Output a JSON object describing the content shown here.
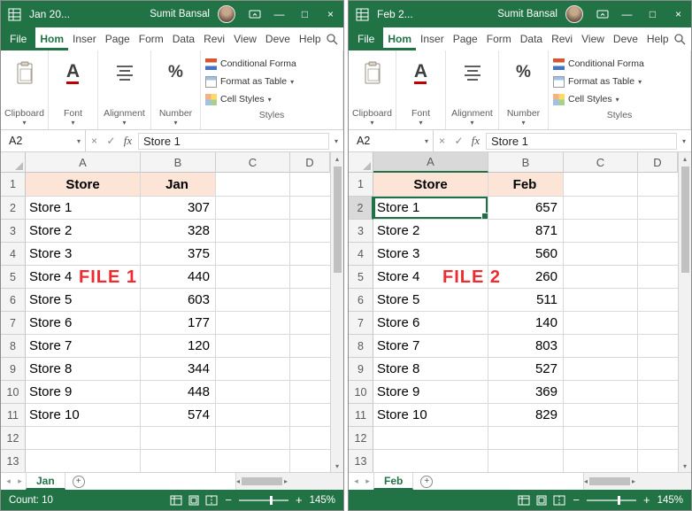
{
  "colors": {
    "excel_green": "#217346",
    "header_fill": "#FCE4D6",
    "overlay_red": "#EE2B2E"
  },
  "glyphs": {
    "caret_down": "▾",
    "minimize": "—",
    "maximize": "□",
    "close": "×",
    "cancel": "×",
    "enter": "✓",
    "fx": "fx",
    "up": "▴",
    "down": "▾",
    "left": "◂",
    "right": "▸",
    "plus": "+",
    "minus": "−"
  },
  "windows": [
    {
      "title": "Jan 20...",
      "user": "Sumit Bansal",
      "ribbon_tabs": [
        "File",
        "Hom",
        "Inser",
        "Page",
        "Form",
        "Data",
        "Revi",
        "View",
        "Deve",
        "Help"
      ],
      "groups": {
        "clipboard": "Clipboard",
        "font": "Font",
        "alignment": "Alignment",
        "number": "Number",
        "styles": "Styles",
        "conditional": "Conditional Forma",
        "format_table": "Format as Table",
        "cell_styles": "Cell Styles"
      },
      "name_box": "A2",
      "formula": "Store 1",
      "col_headers": [
        "A",
        "B",
        "C",
        "D"
      ],
      "row_numbers": [
        "1",
        "2",
        "3",
        "4",
        "5",
        "6",
        "7",
        "8",
        "9",
        "10",
        "11",
        "12",
        "13"
      ],
      "header_row": {
        "a": "Store",
        "b": "Jan"
      },
      "rows": [
        {
          "a": "Store 1",
          "b": "307"
        },
        {
          "a": "Store 2",
          "b": "328"
        },
        {
          "a": "Store 3",
          "b": "375"
        },
        {
          "a": "Store 4",
          "b": "440"
        },
        {
          "a": "Store 5",
          "b": "603"
        },
        {
          "a": "Store 6",
          "b": "177"
        },
        {
          "a": "Store 7",
          "b": "120"
        },
        {
          "a": "Store 8",
          "b": "344"
        },
        {
          "a": "Store 9",
          "b": "448"
        },
        {
          "a": "Store 10",
          "b": "574"
        }
      ],
      "overlay": "FILE 1",
      "sheet_tab": "Jan",
      "status": {
        "left": "Count: 10",
        "zoom": "145%"
      }
    },
    {
      "title": "Feb 2...",
      "user": "Sumit Bansal",
      "ribbon_tabs": [
        "File",
        "Hom",
        "Inser",
        "Page",
        "Form",
        "Data",
        "Revi",
        "View",
        "Deve",
        "Help"
      ],
      "groups": {
        "clipboard": "Clipboard",
        "font": "Font",
        "alignment": "Alignment",
        "number": "Number",
        "styles": "Styles",
        "conditional": "Conditional Forma",
        "format_table": "Format as Table",
        "cell_styles": "Cell Styles"
      },
      "name_box": "A2",
      "formula": "Store 1",
      "col_headers": [
        "A",
        "B",
        "C",
        "D"
      ],
      "row_numbers": [
        "1",
        "2",
        "3",
        "4",
        "5",
        "6",
        "7",
        "8",
        "9",
        "10",
        "11",
        "12",
        "13"
      ],
      "header_row": {
        "a": "Store",
        "b": "Feb"
      },
      "rows": [
        {
          "a": "Store 1",
          "b": "657"
        },
        {
          "a": "Store 2",
          "b": "871"
        },
        {
          "a": "Store 3",
          "b": "560"
        },
        {
          "a": "Store 4",
          "b": "260"
        },
        {
          "a": "Store 5",
          "b": "511"
        },
        {
          "a": "Store 6",
          "b": "140"
        },
        {
          "a": "Store 7",
          "b": "803"
        },
        {
          "a": "Store 8",
          "b": "527"
        },
        {
          "a": "Store 9",
          "b": "369"
        },
        {
          "a": "Store 10",
          "b": "829"
        }
      ],
      "overlay": "FILE 2",
      "sheet_tab": "Feb",
      "status": {
        "left": "",
        "zoom": "145%"
      }
    }
  ]
}
